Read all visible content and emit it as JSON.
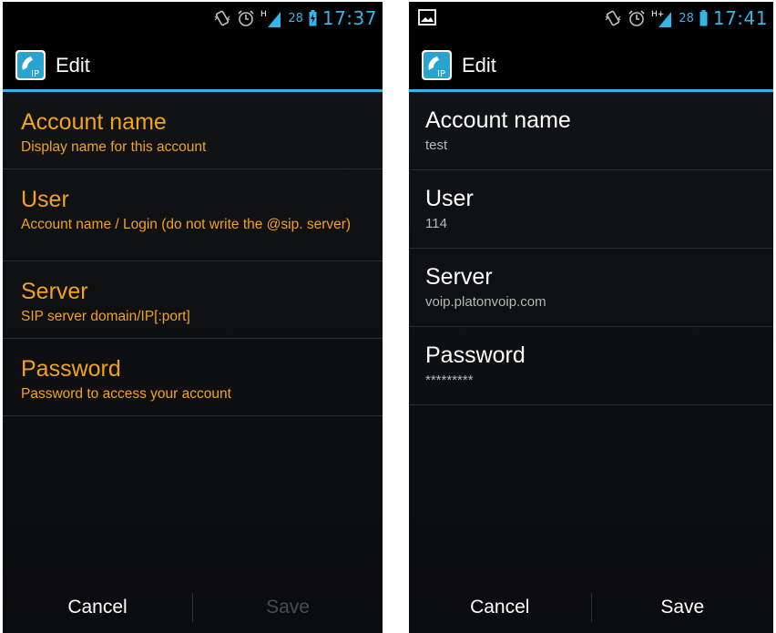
{
  "screens": [
    {
      "status_bar": {
        "battery": "28",
        "time": "17:37",
        "network": "H"
      },
      "action_bar": {
        "title": "Edit",
        "icon": "voip-phone-icon"
      },
      "preferences": [
        {
          "title": "Account name",
          "summary": "Display name for this account"
        },
        {
          "title": "User",
          "summary": "Account name / Login (do not write the @sip. server)"
        },
        {
          "title": "Server",
          "summary": "SIP server domain/IP[:port]"
        },
        {
          "title": "Password",
          "summary": "Password to access your account"
        }
      ],
      "buttons": {
        "cancel": "Cancel",
        "save": "Save",
        "save_enabled": false
      }
    },
    {
      "status_bar": {
        "battery": "28",
        "time": "17:41",
        "network": "H+"
      },
      "action_bar": {
        "title": "Edit",
        "icon": "voip-phone-icon"
      },
      "preferences": [
        {
          "title": "Account name",
          "summary": "test"
        },
        {
          "title": "User",
          "summary": "114"
        },
        {
          "title": "Server",
          "summary": "voip.platonvoip.com"
        },
        {
          "title": "Password",
          "summary": "*********"
        }
      ],
      "buttons": {
        "cancel": "Cancel",
        "save": "Save",
        "save_enabled": true
      }
    }
  ],
  "colors": {
    "accent": "#33b5e5",
    "orange": "#f2a31a",
    "background": "#0b0c0e"
  }
}
